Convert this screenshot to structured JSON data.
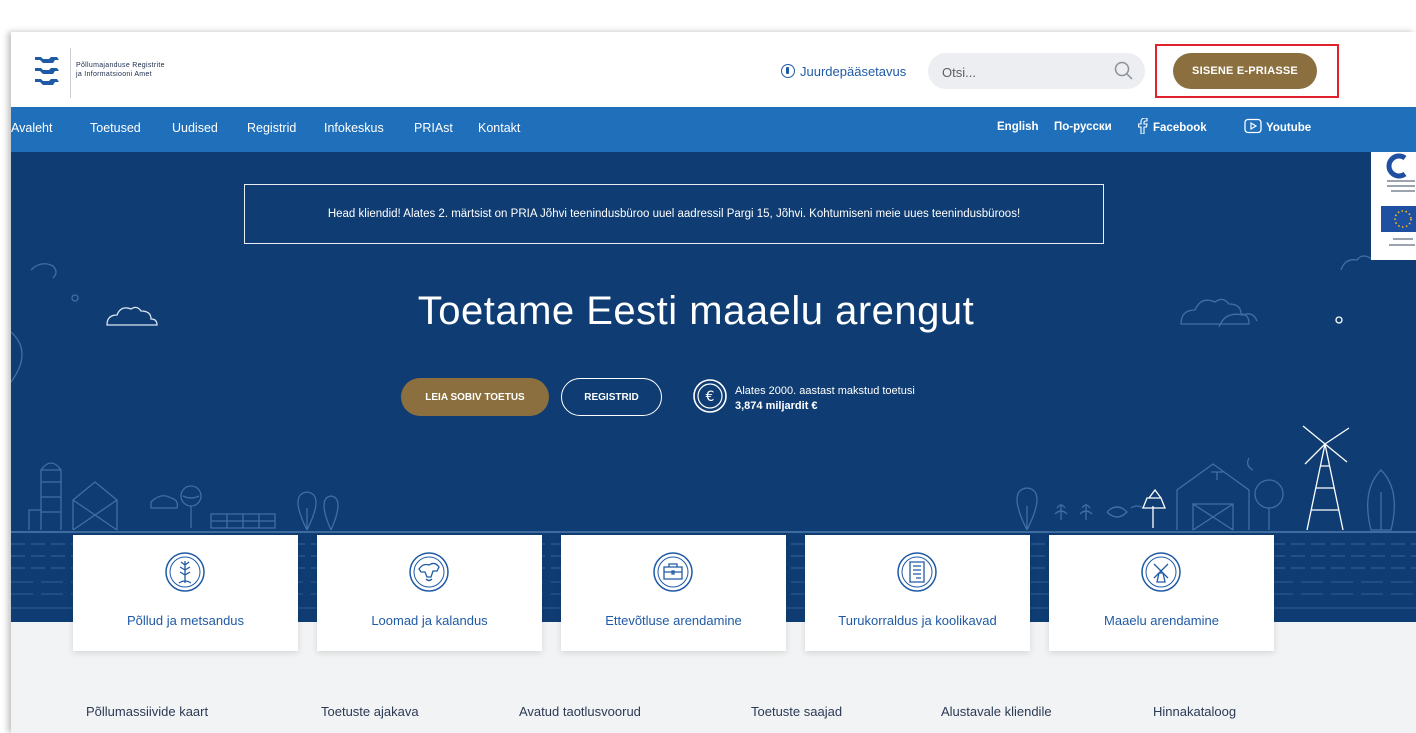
{
  "header": {
    "logo_text_line1": "Põllumajanduse Registrite",
    "logo_text_line2": "ja Informatsiooni Amet",
    "accessibility_label": "Juurdepääsetavus",
    "search_placeholder": "Otsi...",
    "login_button": "SISENE E-PRIASSE"
  },
  "nav": {
    "items": [
      "Avaleht",
      "Toetused",
      "Uudised",
      "Registrid",
      "Infokeskus",
      "PRIAst",
      "Kontakt"
    ],
    "lang_en": "English",
    "lang_ru": "По-русски",
    "facebook": "Facebook",
    "youtube": "Youtube"
  },
  "hero": {
    "notice": "Head kliendid! Alates 2. märtsist on PRIA Jõhvi teenindusbüroo uuel aadressil Pargi 15, Jõhvi. Kohtumiseni meie uues teenindusbüroos!",
    "title": "Toetame Eesti maaelu arengut",
    "button_primary": "LEIA SOBIV TOETUS",
    "button_secondary": "REGISTRID",
    "stat_line1": "Alates 2000. aastast makstud toetusi",
    "stat_line2": "3,874 miljardit €"
  },
  "categories": [
    {
      "label": "Põllud ja metsandus",
      "icon": "wheat-icon"
    },
    {
      "label": "Loomad ja kalandus",
      "icon": "animals-icon"
    },
    {
      "label": "Ettevõtluse arendamine",
      "icon": "briefcase-icon"
    },
    {
      "label": "Turukorraldus ja koolikavad",
      "icon": "document-icon"
    },
    {
      "label": "Maaelu arendamine",
      "icon": "windmill-icon"
    }
  ],
  "quick_links": [
    "Põllumassiivide kaart",
    "Toetuste ajakava",
    "Avatud taotlusvoorud",
    "Toetuste saajad",
    "Alustavale kliendile",
    "Hinnakataloog"
  ],
  "colors": {
    "nav_blue": "#1f6fbb",
    "hero_navy": "#0f3d73",
    "gold": "#8b6f3e",
    "highlight_red": "#e0212e"
  }
}
